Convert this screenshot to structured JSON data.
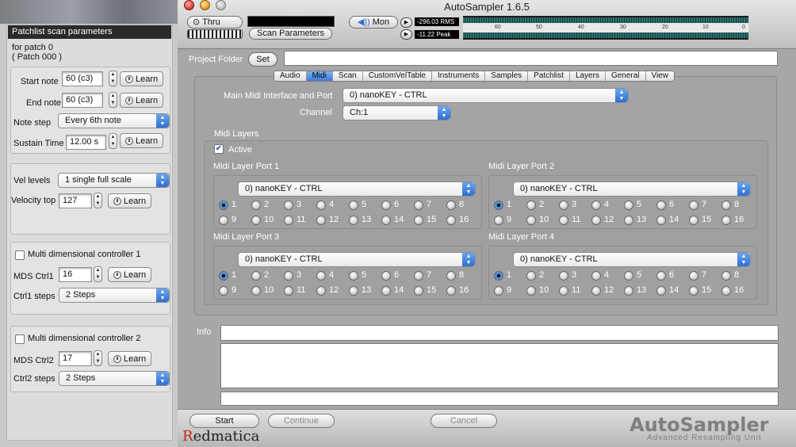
{
  "app": {
    "title": "AutoSampler 1.6.5"
  },
  "toolbar": {
    "thru_label": "Thru",
    "scan_params_label": "Scan Parameters",
    "mon_label": "Mon",
    "rms_value": "-296.03 RMS",
    "peak_value": "-11.22 Peak",
    "meter_ticks": [
      "60",
      "50",
      "40",
      "30",
      "20",
      "10",
      "0"
    ]
  },
  "left": {
    "header": "Patchlist scan parameters",
    "patch_line1": "for patch 0",
    "patch_line2": "( Patch 000 )",
    "start_note_label": "Start note",
    "start_note_value": "60 (c3)",
    "end_note_label": "End note",
    "end_note_value": "60 (c3)",
    "note_step_label": "Note step",
    "note_step_value": "Every 6th note",
    "sustain_label": "Sustain Time",
    "sustain_value": "12.00 s",
    "vel_levels_label": "Vel levels",
    "vel_levels_value": "1 single full scale",
    "velocity_top_label": "Velocity top",
    "velocity_top_value": "127",
    "learn_label": "Learn",
    "mdc1_label": "Multi dimensional controller 1",
    "mds1_label": "MDS Ctrl1",
    "mds1_value": "16",
    "ctrl1_steps_label": "Ctrl1 steps",
    "ctrl1_steps_value": "2 Steps",
    "mdc2_label": "Multi dimensional controller 2",
    "mds2_label": "MDS Ctrl2",
    "mds2_value": "17",
    "ctrl2_steps_label": "Ctrl2 steps",
    "ctrl2_steps_value": "2 Steps"
  },
  "main": {
    "project_folder_label": "Project Folder",
    "set_label": "Set",
    "tabs": [
      "Audio",
      "Midi",
      "Scan",
      "CustomVelTable",
      "Instruments",
      "Samples",
      "Patchlist",
      "Layers",
      "General",
      "View"
    ],
    "active_tab": "Midi",
    "midi_port_label": "Main Midi Interface and Port",
    "midi_port_value": "0) nanoKEY - CTRL",
    "channel_label": "Channel",
    "channel_value": "Ch:1",
    "midi_layers_label": "Midi Layers",
    "active_label": "Active",
    "ports": [
      {
        "label": "Midi Layer Port 1",
        "device": "0) nanoKEY - CTRL"
      },
      {
        "label": "Midi Layer Port 2",
        "device": "0) nanoKEY - CTRL"
      },
      {
        "label": "Midi Layer Port 3",
        "device": "0) nanoKEY - CTRL"
      },
      {
        "label": "Midi Layer Port 4",
        "device": "0) nanoKEY - CTRL"
      }
    ],
    "channel_numbers": [
      "1",
      "2",
      "3",
      "4",
      "5",
      "6",
      "7",
      "8",
      "9",
      "10",
      "11",
      "12",
      "13",
      "14",
      "15",
      "16"
    ],
    "info_label": "Info"
  },
  "bottom": {
    "start_label": "Start",
    "continue_label": "Continue",
    "cancel_label": "Cancel",
    "brand_first": "R",
    "brand_rest": "edmatica",
    "logo": "AutoSampler",
    "logo_sub": "Advanced Resampling Unit"
  }
}
